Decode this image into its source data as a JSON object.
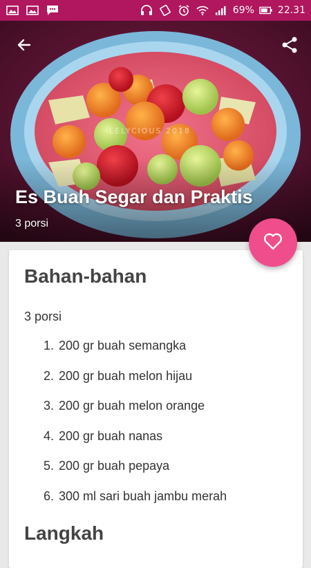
{
  "status_bar": {
    "battery_percent": "69%",
    "time": "22.31",
    "icons": [
      "image-icon",
      "image-icon",
      "message-icon",
      "headphones-icon",
      "rotate-icon",
      "alarm-icon",
      "wifi-icon",
      "signal-icon",
      "battery-icon"
    ]
  },
  "hero": {
    "title": "Es Buah Segar dan Praktis",
    "subtitle": "3 porsi",
    "watermark": "LELYCIOUS  2018"
  },
  "ingredients": {
    "heading": "Bahan-bahan",
    "portion": "3 porsi",
    "items": [
      {
        "num": "1.",
        "text": "200 gr buah semangka"
      },
      {
        "num": "2.",
        "text": "200 gr buah melon hijau"
      },
      {
        "num": "3.",
        "text": "200 gr buah melon orange"
      },
      {
        "num": "4.",
        "text": "200 gr buah nanas"
      },
      {
        "num": "5.",
        "text": "200 gr buah pepaya"
      },
      {
        "num": "6.",
        "text": "300 ml sari buah jambu merah"
      }
    ]
  },
  "steps": {
    "heading": "Langkah"
  },
  "colors": {
    "status_bar": "#b0175e",
    "fab": "#ef4d8c"
  }
}
